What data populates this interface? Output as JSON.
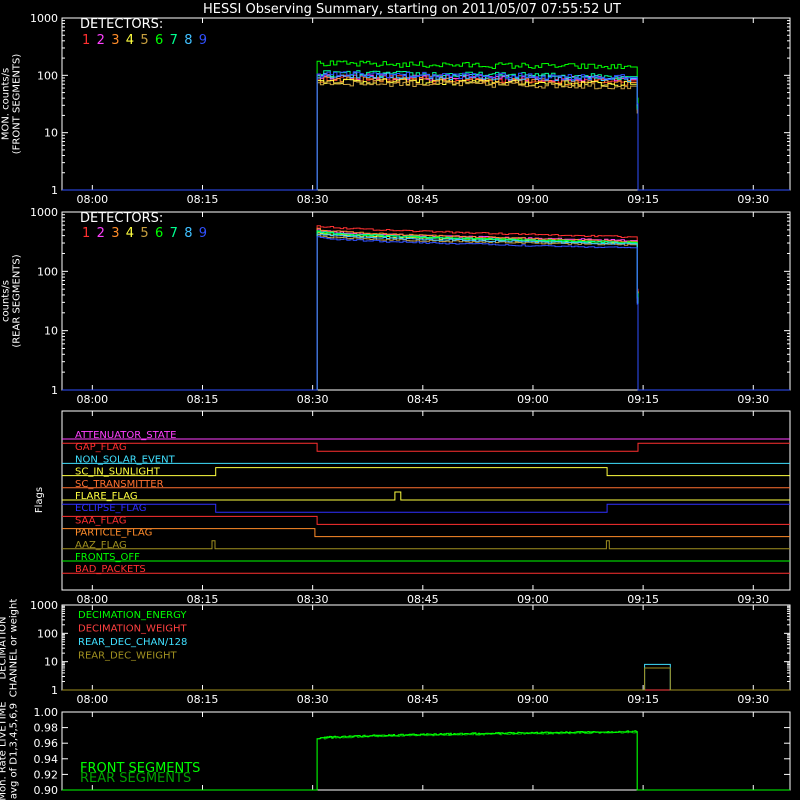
{
  "title": "HESSI Observing Summary, starting on 2011/05/07 07:55:52 UT",
  "colors": {
    "background": "#000000",
    "axes": "#ffffff",
    "detectors": [
      "#ff3030",
      "#ff40ff",
      "#ff8c2a",
      "#ffff40",
      "#c8a040",
      "#00ff00",
      "#00ff90",
      "#40c0ff",
      "#3050ff"
    ],
    "flags": {
      "ATTENUATOR_STATE": "#ff40ff",
      "GAP_FLAG": "#ff3030",
      "NON_SOLAR_EVENT": "#40e0ff",
      "SC_IN_SUNLIGHT": "#ffff40",
      "SC_TRANSMITTER": "#ff7030",
      "FLARE_FLAG": "#ffff40",
      "ECLIPSE_FLAG": "#3030ff",
      "SAA_FLAG": "#ff3030",
      "PARTICLE_FLAG": "#ff8c2a",
      "AAZ_FLAG": "#a09020",
      "FRONTS_OFF": "#00ff00",
      "BAD_PACKETS": "#ff3030"
    },
    "decimation": [
      "#00ff00",
      "#ff4040",
      "#40e0ff",
      "#a09020"
    ],
    "livetime": [
      "#00ff00",
      "#00a000"
    ]
  },
  "x_axis": {
    "range_min": [
      475.87,
      575
    ],
    "ticks": [
      "08:00",
      "08:15",
      "08:30",
      "08:45",
      "09:00",
      "09:15",
      "09:30"
    ],
    "tick_min": [
      480,
      495,
      510,
      525,
      540,
      555,
      570
    ]
  },
  "chart_data": [
    {
      "type": "line",
      "id": "front",
      "ylabel": [
        "MON. counts/s",
        "(FRONT SEGMENTS)"
      ],
      "ylog": true,
      "ylim": [
        1,
        1000
      ],
      "yticks": [
        "1",
        "10",
        "100",
        "1000"
      ],
      "legend": {
        "title": "DETECTORS:",
        "labels": [
          "1",
          "2",
          "3",
          "4",
          "5",
          "6",
          "7",
          "8",
          "9"
        ]
      },
      "series_base": [
        80,
        85,
        75,
        70,
        65,
        140,
        95,
        88,
        92
      ],
      "start_min": 510.6,
      "end_min": 553.3,
      "drop": {
        "min": 554.2,
        "values": [
          30,
          25,
          35,
          28,
          22,
          40,
          26,
          30,
          32
        ]
      },
      "noise": 0.12
    },
    {
      "type": "line",
      "id": "rear",
      "ylabel": [
        "counts/s",
        "(REAR SEGMENTS)"
      ],
      "ylog": true,
      "ylim": [
        1,
        1000
      ],
      "yticks": [
        "1",
        "10",
        "100",
        "1000"
      ],
      "legend": {
        "title": "DETECTORS:",
        "labels": [
          "1",
          "2",
          "3",
          "4",
          "5",
          "6",
          "7",
          "8",
          "9"
        ]
      },
      "series_start": [
        600,
        500,
        520,
        450,
        400,
        470,
        480,
        430,
        380
      ],
      "series_end": [
        380,
        330,
        320,
        300,
        280,
        310,
        300,
        290,
        250
      ],
      "start_min": 510.6,
      "end_min": 553.3,
      "drop": {
        "min": 554.2,
        "values": [
          50,
          40,
          35,
          45,
          30,
          38,
          42,
          36,
          28
        ]
      },
      "noise": 0.03
    },
    {
      "type": "flags",
      "id": "flags",
      "ylabel": [
        "Flags"
      ],
      "rows": [
        {
          "name": "ATTENUATOR_STATE",
          "steps": [
            [
              475.87,
              0
            ]
          ]
        },
        {
          "name": "GAP_FLAG",
          "steps": [
            [
              475.87,
              1
            ],
            [
              510.6,
              0
            ],
            [
              554.3,
              1
            ]
          ]
        },
        {
          "name": "NON_SOLAR_EVENT",
          "steps": [
            [
              475.87,
              0
            ]
          ]
        },
        {
          "name": "SC_IN_SUNLIGHT",
          "steps": [
            [
              475.87,
              0
            ],
            [
              496.8,
              1
            ],
            [
              550.1,
              0
            ]
          ]
        },
        {
          "name": "SC_TRANSMITTER",
          "steps": [
            [
              475.87,
              0
            ]
          ]
        },
        {
          "name": "FLARE_FLAG",
          "steps": [
            [
              475.87,
              0
            ],
            [
              521.2,
              1
            ],
            [
              522.0,
              0
            ]
          ]
        },
        {
          "name": "ECLIPSE_FLAG",
          "steps": [
            [
              475.87,
              1
            ],
            [
              496.8,
              0
            ],
            [
              550.1,
              1
            ]
          ]
        },
        {
          "name": "SAA_FLAG",
          "steps": [
            [
              475.87,
              1
            ],
            [
              510.6,
              0
            ]
          ]
        },
        {
          "name": "PARTICLE_FLAG",
          "steps": [
            [
              475.87,
              1
            ],
            [
              510.3,
              0
            ]
          ]
        },
        {
          "name": "AAZ_FLAG",
          "steps": [
            [
              475.87,
              0
            ],
            [
              496.3,
              1
            ],
            [
              496.7,
              0
            ],
            [
              550.0,
              1
            ],
            [
              550.4,
              0
            ]
          ]
        },
        {
          "name": "FRONTS_OFF",
          "steps": [
            [
              475.87,
              0
            ]
          ]
        },
        {
          "name": "BAD_PACKETS",
          "steps": [
            [
              475.87,
              0
            ]
          ]
        }
      ]
    },
    {
      "type": "line",
      "id": "decimation",
      "ylabel": [
        "DECIMATION",
        "CHANNEL or weight"
      ],
      "ylog": true,
      "ylim": [
        1,
        1000
      ],
      "yticks": [
        "1",
        "10",
        "100",
        "1000"
      ],
      "legend": {
        "labels": [
          "DECIMATION_ENERGY",
          "DECIMATION_WEIGHT",
          "REAR_DEC_CHAN/128",
          "REAR_DEC_WEIGHT"
        ]
      },
      "series": [
        {
          "name": "DECIMATION_ENERGY",
          "points": [
            [
              475.87,
              1
            ],
            [
              575,
              1
            ]
          ]
        },
        {
          "name": "DECIMATION_WEIGHT",
          "points": [
            [
              475.87,
              1
            ],
            [
              575,
              1
            ]
          ]
        },
        {
          "name": "REAR_DEC_CHAN/128",
          "points": [
            [
              475.87,
              1
            ],
            [
              555.2,
              1
            ],
            [
              555.2,
              8
            ],
            [
              558.7,
              8
            ],
            [
              558.7,
              1
            ],
            [
              575,
              1
            ]
          ]
        },
        {
          "name": "REAR_DEC_WEIGHT",
          "points": [
            [
              475.87,
              1
            ],
            [
              555.2,
              1
            ],
            [
              555.2,
              6
            ],
            [
              558.7,
              6
            ],
            [
              558.7,
              1
            ],
            [
              575,
              1
            ]
          ]
        }
      ]
    },
    {
      "type": "line",
      "id": "livetime",
      "ylabel": [
        "Mon. Rate LIVETIME",
        "avg of D1,3,4,5,6,9"
      ],
      "ylim": [
        0.9,
        1.0
      ],
      "yticks": [
        "0.90",
        "0.92",
        "0.94",
        "0.96",
        "0.98",
        "1.00"
      ],
      "legend": {
        "labels": [
          "FRONT SEGMENTS",
          "REAR SEGMENTS"
        ]
      },
      "start_min": 510.6,
      "end_min": 554.2,
      "y_start": 0.966,
      "y_end": 0.975
    }
  ]
}
